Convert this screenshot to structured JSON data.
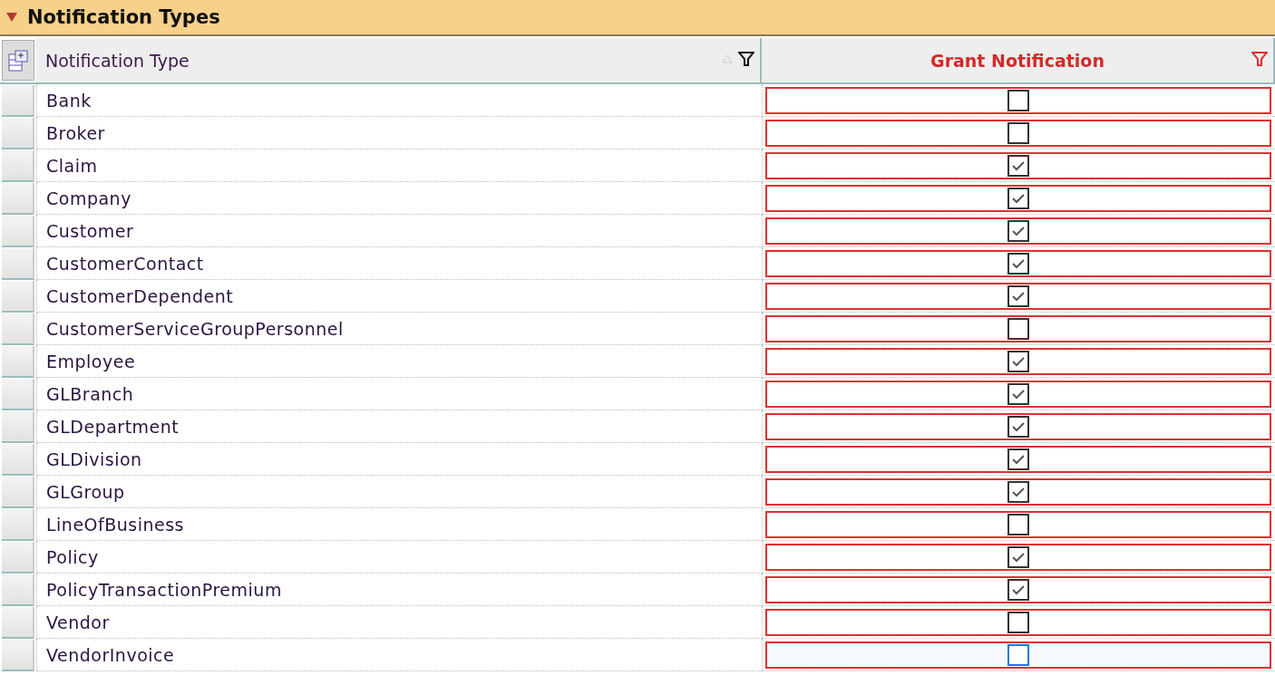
{
  "panel": {
    "title": "Notification Types",
    "expanded": true
  },
  "table": {
    "columns": [
      {
        "label": "Notification Type",
        "kind": "text",
        "filter_active": false
      },
      {
        "label": "Grant Notification",
        "kind": "checkbox",
        "filter_active": true
      }
    ],
    "rows": [
      {
        "name": "Bank",
        "granted": false,
        "focused": false
      },
      {
        "name": "Broker",
        "granted": false,
        "focused": false
      },
      {
        "name": "Claim",
        "granted": true,
        "focused": false
      },
      {
        "name": "Company",
        "granted": true,
        "focused": false
      },
      {
        "name": "Customer",
        "granted": true,
        "focused": false
      },
      {
        "name": "CustomerContact",
        "granted": true,
        "focused": false
      },
      {
        "name": "CustomerDependent",
        "granted": true,
        "focused": false
      },
      {
        "name": "CustomerServiceGroupPersonnel",
        "granted": false,
        "focused": false
      },
      {
        "name": "Employee",
        "granted": true,
        "focused": false
      },
      {
        "name": "GLBranch",
        "granted": true,
        "focused": false
      },
      {
        "name": "GLDepartment",
        "granted": true,
        "focused": false
      },
      {
        "name": "GLDivision",
        "granted": true,
        "focused": false
      },
      {
        "name": "GLGroup",
        "granted": true,
        "focused": false
      },
      {
        "name": "LineOfBusiness",
        "granted": false,
        "focused": false
      },
      {
        "name": "Policy",
        "granted": true,
        "focused": false
      },
      {
        "name": "PolicyTransactionPremium",
        "granted": true,
        "focused": false
      },
      {
        "name": "Vendor",
        "granted": false,
        "focused": false
      },
      {
        "name": "VendorInvoice",
        "granted": false,
        "focused": true
      }
    ]
  }
}
